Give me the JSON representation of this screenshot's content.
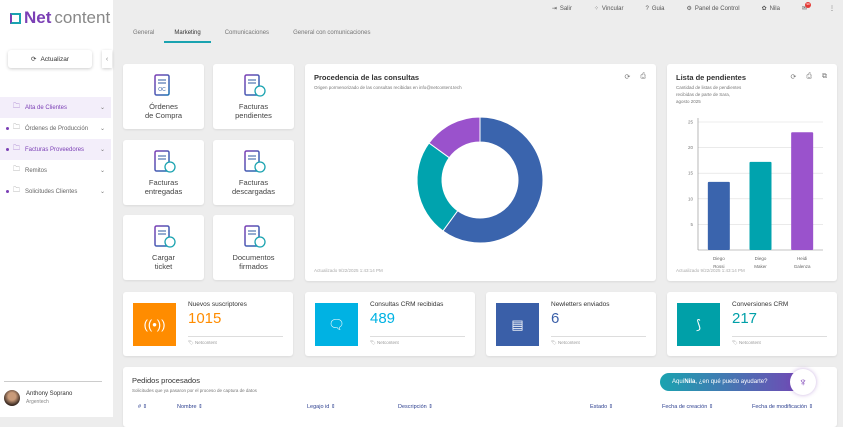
{
  "app": {
    "brand_bold": "Net",
    "brand_light": "content"
  },
  "sidebar": {
    "refresh_label": "Actualizar",
    "items": [
      {
        "label": "Alta de Clientes",
        "active": true,
        "dot": false
      },
      {
        "label": "Órdenes de Producción",
        "active": false,
        "dot": true
      },
      {
        "label": "Facturas Proveedores",
        "active": true,
        "dot": true
      },
      {
        "label": "Remitos",
        "active": false,
        "dot": false
      },
      {
        "label": "Solicitudes Clientes",
        "active": false,
        "dot": true
      }
    ],
    "user": {
      "name": "Anthony Soprano",
      "company": "Argentech"
    }
  },
  "topbar": {
    "items": [
      "Salir",
      "Vincular",
      "Guia",
      "Panel de Control",
      "Nila"
    ],
    "notification_count": "99"
  },
  "tabs": [
    "General",
    "Marketing",
    "Comunicaciones",
    "General con comunicaciones"
  ],
  "tiles": [
    {
      "l1": "Órdenes",
      "l2": "de Compra",
      "icon": "purchase-order-icon"
    },
    {
      "l1": "Facturas",
      "l2": "pendientes",
      "icon": "invoice-clock-icon"
    },
    {
      "l1": "Facturas",
      "l2": "entregadas",
      "icon": "invoice-send-icon"
    },
    {
      "l1": "Facturas",
      "l2": "descargadas",
      "icon": "invoice-download-icon"
    },
    {
      "l1": "Cargar",
      "l2": "ticket",
      "icon": "ticket-add-icon"
    },
    {
      "l1": "Documentos",
      "l2": "firmados",
      "icon": "signed-document-icon"
    }
  ],
  "donut": {
    "title": "Procedencia de las consultas",
    "subtitle": "Origen pormenorizado de las consultas recibidas en info@netcontent.tech",
    "updated": "Actualizado 9/22/2025 1:43:14 PM"
  },
  "pendientes": {
    "title": "Lista de pendientes",
    "subtitle1": "Cantidad de listas de pendientes",
    "subtitle2": "recibidas de parte de Sara,",
    "subtitle3": "agosto 2025",
    "updated": "Actualizado 9/22/2025 1:43:14 PM"
  },
  "chart_data": [
    {
      "type": "pie",
      "variant": "donut",
      "values": [
        60,
        25,
        15
      ],
      "colors": [
        "#3a64ad",
        "#00a3ae",
        "#9a52cc"
      ]
    },
    {
      "type": "bar",
      "categories": [
        [
          "Diego",
          "Rossi"
        ],
        [
          "Diego",
          "Maker"
        ],
        [
          "Heidi",
          "Galenza"
        ]
      ],
      "values": [
        13.3,
        17.2,
        23
      ],
      "colors": [
        "#3a64ad",
        "#00a3ae",
        "#9a52cc"
      ],
      "yticks": [
        5,
        10,
        15,
        20,
        25
      ],
      "ylim": [
        0,
        25
      ],
      "grid": true
    }
  ],
  "kpis": [
    {
      "title": "Nuevos suscriptores",
      "value": "1015",
      "source": "Netcontent",
      "color": "#ff8c00",
      "icon": "broadcast-icon"
    },
    {
      "title": "Consultas CRM recibidas",
      "value": "489",
      "source": "Netcontent",
      "color": "#00b2e3",
      "icon": "chat-icon"
    },
    {
      "title": "Newletters enviados",
      "value": "6",
      "source": "Netcontent",
      "color": "#3a5fa8",
      "icon": "document-icon"
    },
    {
      "title": "Conversiones CRM",
      "value": "217",
      "source": "Netcontent",
      "color": "#00a0a8",
      "icon": "route-icon"
    }
  ],
  "table": {
    "title": "Pedidos procesados",
    "subtitle": "Solicitudes que ya pasaron por el proceso de captura de datos",
    "columns": [
      "#",
      "Nombre",
      "Legajo id",
      "Descripción",
      "Estado",
      "Fecha de creación",
      "Fecha de modificación"
    ]
  },
  "assistant": {
    "prefix": "Aquí ",
    "name": "Nila",
    "suffix": ", ¿en qué puedo ayudarte?"
  }
}
